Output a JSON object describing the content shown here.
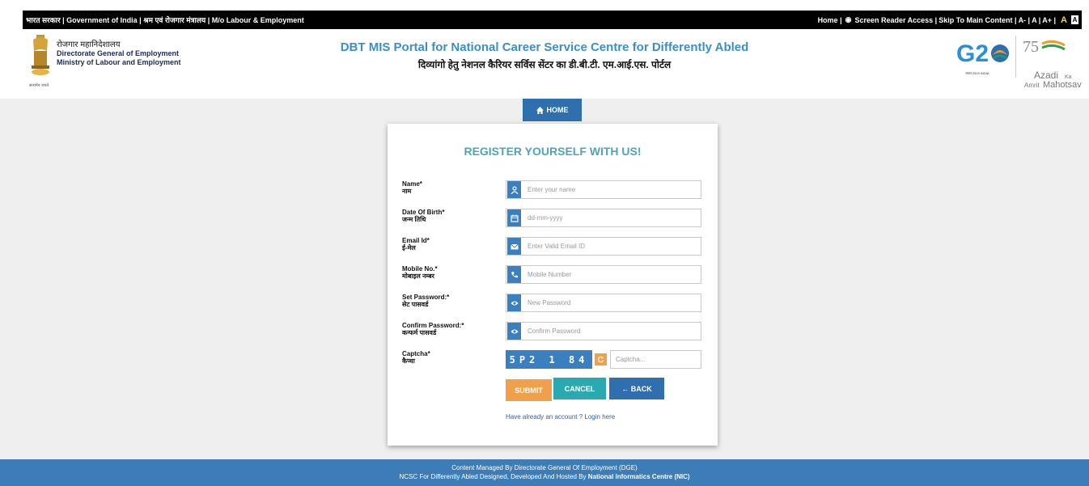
{
  "topbar": {
    "left_text": "भारत सरकार | Government of India | श्रम एवं रोजगार मंत्रालय | M/o Labour & Employment",
    "home": "Home |",
    "screen_reader": "Screen Reader Access |",
    "skip": "Skip To Main Content |",
    "a_minus": "A- |",
    "a": "A |",
    "a_plus": "A+ |",
    "font_a": "A",
    "contrast": "A"
  },
  "header": {
    "org_hindi": "रोजगार महानिदेशालय",
    "org_en_1": "Directorate General of Employment",
    "org_en_2": "Ministry of Labour and Employment",
    "portal_en": "DBT MIS Portal for National Career Service Centre for Differently Abled",
    "portal_hi": "दिव्यांगो हेतु नेशनल कैरियर सर्विस सेंटर का डी.बी.टी. एम.आई.एस. पोर्टल",
    "emblem_text": "सत्यमेव जयते",
    "g20_sub": "भारत 2023 INDIA",
    "azadi_ka": "Ka",
    "azadi_word": "Azadi",
    "azadi_amrit": "Amrit",
    "azadi_mahotsav": "Mahotsav"
  },
  "nav": {
    "home_label": "HOME"
  },
  "form": {
    "title": "REGISTER YOURSELF WITH US!",
    "fields": [
      {
        "label_en": "Name*",
        "label_hi": "नाम",
        "placeholder": "Enter your name",
        "icon": "user-icon"
      },
      {
        "label_en": "Date Of Birth*",
        "label_hi": "जन्म तिथि",
        "placeholder": "dd-mm-yyyy",
        "icon": "calendar-icon"
      },
      {
        "label_en": "Email Id*",
        "label_hi": "ई-मेल",
        "placeholder": "Enter Valid Email ID",
        "icon": "envelope-icon"
      },
      {
        "label_en": "Mobile No.*",
        "label_hi": "मोबाइल नम्बर",
        "placeholder": "Mobile Number",
        "icon": "phone-icon"
      },
      {
        "label_en": "Set Password:*",
        "label_hi": "सेट पासवर्ड",
        "placeholder": "New Password",
        "icon": "eye-icon"
      },
      {
        "label_en": "Confirm Password:*",
        "label_hi": "कन्फर्म पासवर्ड",
        "placeholder": "Confirm Password",
        "icon": "eye-icon"
      }
    ],
    "captcha": {
      "label_en": "Captcha*",
      "label_hi": "कैप्चा",
      "code": "5P2 1 84",
      "placeholder": "Captcha..."
    },
    "buttons": {
      "submit": "SUBMIT",
      "cancel": "CANCEL",
      "back": "← BACK"
    },
    "login_link": "Have already an account ? Login here"
  },
  "footer": {
    "line1": "Content Managed By Directorate General Of Employment (DGE)",
    "line2_prefix": "NCSC For Differently Abled Designed, Developed And Hosted By ",
    "line2_bold": "National Informatics Centre (NIC)"
  },
  "colors": {
    "primary_blue": "#2f6fae",
    "title_teal": "#4aa6b8",
    "submit_orange": "#f0a04b",
    "cancel_teal": "#2aa9b1",
    "footer_blue": "#3e7cb8"
  }
}
